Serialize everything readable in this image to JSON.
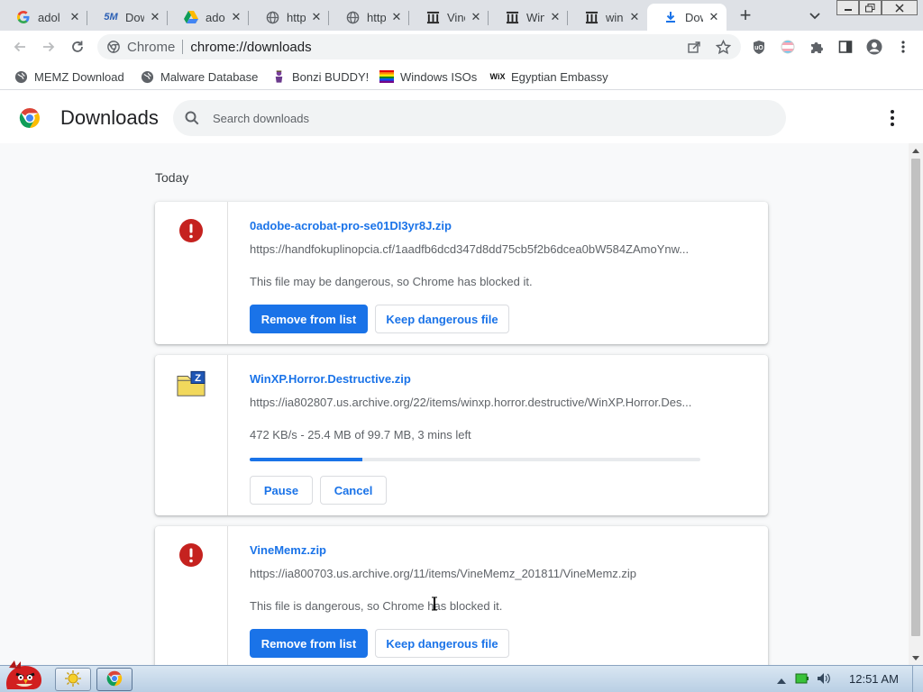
{
  "tabs": [
    {
      "title": "adol",
      "icon": "google-g-icon",
      "active": false
    },
    {
      "title": "Dow",
      "icon": "5m-icon",
      "active": false
    },
    {
      "title": "adol",
      "icon": "google-drive-icon",
      "active": false
    },
    {
      "title": "http",
      "icon": "globe-icon",
      "active": false
    },
    {
      "title": "http",
      "icon": "globe-icon",
      "active": false
    },
    {
      "title": "Vine",
      "icon": "archive-icon",
      "active": false
    },
    {
      "title": "Win",
      "icon": "archive-icon",
      "active": false
    },
    {
      "title": "winx",
      "icon": "archive-icon",
      "active": false
    },
    {
      "title": "Dow",
      "icon": "download-icon",
      "active": true
    }
  ],
  "omnibox": {
    "site_label": "Chrome",
    "url": "chrome://downloads"
  },
  "bookmarks": [
    {
      "label": "MEMZ Download",
      "icon": "globe-icon"
    },
    {
      "label": "Malware Database",
      "icon": "globe-icon"
    },
    {
      "label": "Bonzi BUDDY!",
      "icon": "bonzi-icon"
    },
    {
      "label": "Windows ISOs",
      "icon": "rainbow-flag-icon"
    },
    {
      "label": "Egyptian Embassy",
      "icon": "wix-icon"
    }
  ],
  "downloads_page": {
    "title": "Downloads",
    "search_placeholder": "Search downloads",
    "date_heading": "Today",
    "items": [
      {
        "filename": "0adobe-acrobat-pro-se01DI3yr8J.zip",
        "url": "https://handfokuplinopcia.cf/1aadfb6dcd347d8dd75cb5f2b6dcea0bW584ZAmoYnw...",
        "description": "This file may be dangerous, so Chrome has blocked it.",
        "icon": "danger-icon",
        "primary_button": "Remove from list",
        "secondary_button": "Keep dangerous file"
      },
      {
        "filename": "WinXP.Horror.Destructive.zip",
        "url": "https://ia802807.us.archive.org/22/items/winxp.horror.destructive/WinXP.Horror.Des...",
        "description": "472 KB/s - 25.4 MB of 99.7 MB, 3 mins left",
        "icon": "zip-folder-icon",
        "progress_percent": 25,
        "pause_button": "Pause",
        "cancel_button": "Cancel"
      },
      {
        "filename": "VineMemz.zip",
        "url": "https://ia800703.us.archive.org/11/items/VineMemz_201811/VineMemz.zip",
        "description": "This file is dangerous, so Chrome has blocked it.",
        "icon": "danger-icon",
        "primary_button": "Remove from list",
        "secondary_button": "Keep dangerous file"
      }
    ]
  },
  "taskbar": {
    "clock": "12:51 AM"
  },
  "colors": {
    "accent": "#1a73e8",
    "danger": "#c5221f",
    "tabstrip": "#dee1e6"
  }
}
